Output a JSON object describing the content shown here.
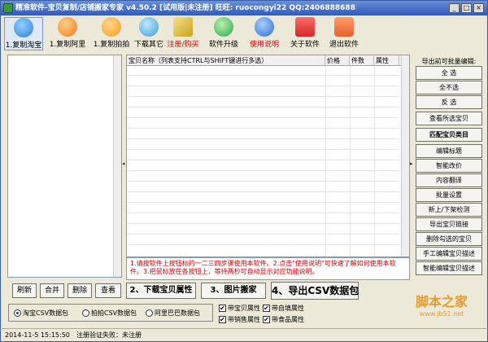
{
  "window": {
    "title": "精准软件-宝贝复制/店铺搬家专家 v4.50.2 [试用版|未注册] 旺旺: ruocongyi22 QQ:2406888688",
    "min": "_",
    "max": "□",
    "close": "×"
  },
  "toolbar": [
    {
      "label": "1.复制淘宝",
      "icon": "taobao-icon",
      "color": "#2f7ed8"
    },
    {
      "label": "1.复制阿里",
      "icon": "alibaba-icon",
      "color": "#f07a1a"
    },
    {
      "label": "1.复制拍拍",
      "icon": "paipai-icon",
      "color": "#f39c24"
    },
    {
      "label": "下载其它",
      "icon": "globe-download-icon",
      "color": "#3aa0d0"
    },
    {
      "label": "注册/购买",
      "icon": "keys-icon",
      "color": "#c9a21a"
    },
    {
      "label": "软件升级",
      "icon": "globe-icon",
      "color": "#2aa84a"
    },
    {
      "label": "使用说明",
      "icon": "help-icon",
      "color": "#2a6fd0"
    },
    {
      "label": "关于软件",
      "icon": "exclamation-icon",
      "color": "#d02a2a"
    },
    {
      "label": "退出软件",
      "icon": "power-icon",
      "color": "#e8622a"
    }
  ],
  "grid": {
    "columns": [
      "宝贝名称（列表支持CTRL与SHIFT键进行多选）",
      "价格",
      "件数",
      "属性"
    ]
  },
  "message": "1.请按软件上按钮标的一二三四步骤使用本软件。2.点击\"使用说明\"可快速了解如何使用本软件。3.把鼠标放在各按钮上，等待两秒可自动显示对应功能说明。",
  "right_panel": {
    "header": "导出前可批量编辑:",
    "buttons": [
      "全  选",
      "全不选",
      "反  选",
      "查看所选宝贝",
      "匹配宝贝类目",
      "编辑标题",
      "智能改价",
      "内容翻译",
      "批量设置",
      "新上/下架检测",
      "导出宝贝链接",
      "删除勾选的宝贝",
      "手工编辑宝贝描述",
      "智能编辑宝贝描述"
    ]
  },
  "bottom_buttons": {
    "refresh": "刷新",
    "merge": "合并",
    "delete": "删除",
    "view": "查看",
    "download_attrs": "2、下载宝贝属性",
    "image_move": "3、图片搬家",
    "export_csv": "4、导出CSV数据包"
  },
  "package_options": [
    {
      "label": "淘宝CSV数据包",
      "selected": true
    },
    {
      "label": "拍拍CSV数据包",
      "selected": false
    },
    {
      "label": "阿里巴巴数据包",
      "selected": false
    }
  ],
  "checkboxes": [
    {
      "label": "带宝贝属性",
      "checked": true
    },
    {
      "label": "带自填属性",
      "checked": true
    },
    {
      "label": "带销售属性",
      "checked": true
    },
    {
      "label": "带食品属性",
      "checked": true
    }
  ],
  "watermark": {
    "title": "脚本之家",
    "url": "www.jb51.net"
  },
  "status": {
    "time": "2014-11-5 15:15:50",
    "message": "注册验证失败：未注册"
  }
}
